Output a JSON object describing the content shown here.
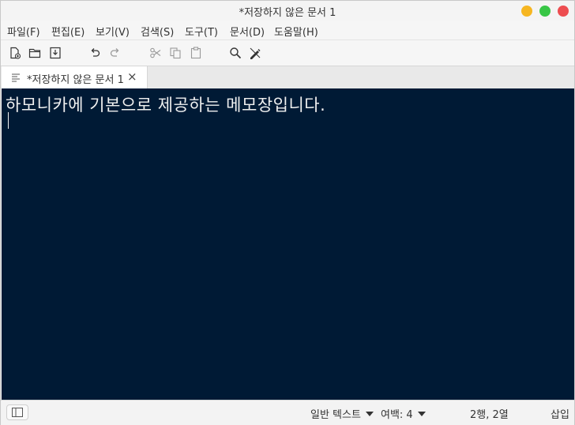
{
  "window": {
    "title": "*저장하지 않은 문서 1"
  },
  "menu": {
    "items": [
      "파일(F)",
      "편집(E)",
      "보기(V)",
      "검색(S)",
      "도구(T)",
      "문서(D)",
      "도움말(H)"
    ]
  },
  "toolbar": {
    "icons": [
      "new-document-icon",
      "open-folder-icon",
      "save-icon",
      "undo-icon",
      "redo-icon",
      "cut-icon",
      "copy-icon",
      "paste-icon",
      "search-icon",
      "spell-check-icon"
    ]
  },
  "tab": {
    "label": "*저장하지 않은 문서 1",
    "close_glyph": "×"
  },
  "editor": {
    "text": "하모니카에 기본으로 제공하는 메모장입니다.",
    "background": "#001a35",
    "foreground": "#f0f0f0"
  },
  "statusbar": {
    "syntax": "일반 텍스트",
    "tab_width_label": "여백: 4",
    "cursor_position": "2행, 2열",
    "insert_mode": "삽입"
  },
  "colors": {
    "minimize": "#f6b621",
    "maximize": "#38c646",
    "close": "#ed4d50"
  }
}
